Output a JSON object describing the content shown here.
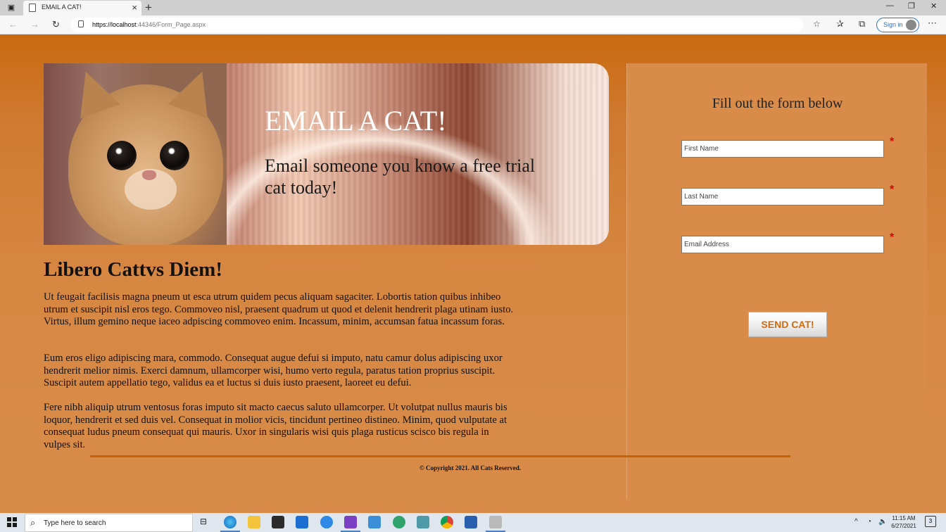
{
  "browser": {
    "tab_title": "EMAIL A CAT!",
    "url_scheme_host": "https://localhost",
    "url_rest": ":44346/Form_Page.aspx",
    "signin_label": "Sign in",
    "new_tab_label": "+",
    "close_tab_label": "×"
  },
  "hero": {
    "title": "EMAIL A CAT!",
    "subtitle": "Email someone you know a free trial cat today!"
  },
  "article": {
    "title": "Libero Cattvs Diem!",
    "paragraphs": [
      "Ut feugait facilisis magna pneum ut esca utrum quidem pecus aliquam sagaciter. Lobortis tation quibus inhibeo utrum et suscipit nisl eros tego. Commoveo nisl, praesent quadrum ut quod et delenit hendrerit plaga utinam iusto. Virtus, illum gemino neque iaceo adpiscing commoveo enim. Incassum, minim, accumsan fatua incassum foras.",
      "Eum eros eligo adipiscing mara, commodo. Consequat augue defui si imputo, natu camur dolus adipiscing uxor hendrerit melior nimis. Exerci damnum, ullamcorper wisi, humo verto regula, paratus tation proprius suscipit. Suscipit autem appellatio tego, validus ea et luctus si duis iusto praesent, laoreet eu defui.",
      "Fere nibh aliquip utrum ventosus foras imputo sit macto caecus saluto ullamcorper. Ut volutpat nullus mauris bis loquor, hendrerit et sed duis vel. Consequat in molior vicis, tincidunt pertineo distineo. Minim, quod vulputate at consequat ludus pneum consequat qui mauris. Uxor in singularis wisi quis plaga rusticus scisco bis regula in vulpes sit."
    ]
  },
  "form": {
    "heading": "Fill out the form below",
    "first_name_placeholder": "First Name",
    "last_name_placeholder": "Last Name",
    "email_placeholder": "Email Address",
    "required_marker": "*",
    "submit_label": "SEND CAT!"
  },
  "footer": {
    "copyright": "© Copyright 2021. All Cats Reserved."
  },
  "taskbar": {
    "search_placeholder": "Type here to search",
    "time": "11:15 AM",
    "date": "6/27/2021",
    "notification_count": "3"
  },
  "colors": {
    "page_bg": "#d98c4a",
    "header_orange": "#c96a10",
    "button_text": "#d26b10",
    "required": "#e00000"
  }
}
